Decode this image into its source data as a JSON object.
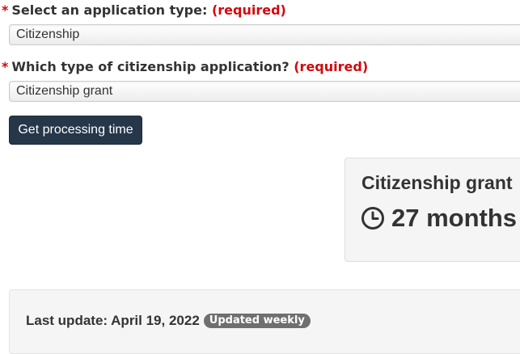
{
  "form": {
    "application_type": {
      "star": "*",
      "label": "Select an application type:",
      "required": "(required)",
      "value": "Citizenship"
    },
    "citizenship_type": {
      "star": "*",
      "label": "Which type of citizenship application?",
      "required": "(required)",
      "value": "Citizenship grant"
    },
    "submit_label": "Get processing time"
  },
  "result": {
    "title": "Citizenship grant",
    "time_icon": "clock-icon",
    "time": "27 months"
  },
  "update": {
    "text": "Last update: April 19, 2022",
    "badge": "Updated weekly"
  },
  "colors": {
    "required": "#d3080c",
    "button_bg": "#26374a",
    "card_bg": "#f5f5f5",
    "badge_bg": "#6f6f6f"
  }
}
